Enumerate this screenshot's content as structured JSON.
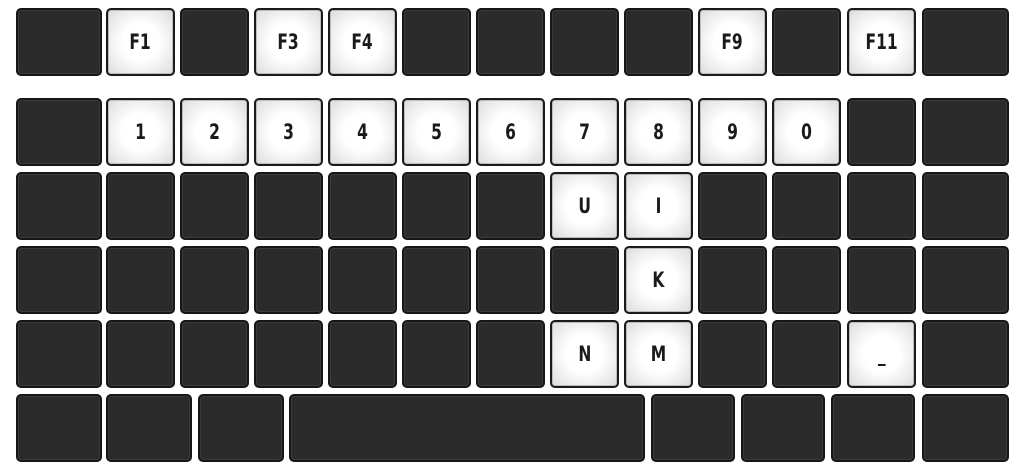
{
  "keyboard": {
    "rows": [
      {
        "name": "function-row",
        "keys": [
          {
            "id": "esc",
            "label": "",
            "lit": false
          },
          {
            "id": "f1",
            "label": "F1",
            "lit": true
          },
          {
            "id": "f2",
            "label": "",
            "lit": false
          },
          {
            "id": "f3",
            "label": "F3",
            "lit": true
          },
          {
            "id": "f4",
            "label": "F4",
            "lit": true
          },
          {
            "id": "f5",
            "label": "",
            "lit": false
          },
          {
            "id": "f6",
            "label": "",
            "lit": false
          },
          {
            "id": "f7",
            "label": "",
            "lit": false
          },
          {
            "id": "f8",
            "label": "",
            "lit": false
          },
          {
            "id": "f9",
            "label": "F9",
            "lit": true
          },
          {
            "id": "f10",
            "label": "",
            "lit": false
          },
          {
            "id": "f11",
            "label": "F11",
            "lit": true
          },
          {
            "id": "f12",
            "label": "",
            "lit": false
          }
        ]
      },
      {
        "name": "number-row",
        "keys": [
          {
            "id": "backtick",
            "label": "",
            "lit": false
          },
          {
            "id": "digit-1",
            "label": "1",
            "lit": true
          },
          {
            "id": "digit-2",
            "label": "2",
            "lit": true
          },
          {
            "id": "digit-3",
            "label": "3",
            "lit": true
          },
          {
            "id": "digit-4",
            "label": "4",
            "lit": true
          },
          {
            "id": "digit-5",
            "label": "5",
            "lit": true
          },
          {
            "id": "digit-6",
            "label": "6",
            "lit": true
          },
          {
            "id": "digit-7",
            "label": "7",
            "lit": true
          },
          {
            "id": "digit-8",
            "label": "8",
            "lit": true
          },
          {
            "id": "digit-9",
            "label": "9",
            "lit": true
          },
          {
            "id": "digit-0",
            "label": "0",
            "lit": true
          },
          {
            "id": "minus",
            "label": "",
            "lit": false
          },
          {
            "id": "backspace",
            "label": "",
            "lit": false
          }
        ]
      },
      {
        "name": "top-letter-row",
        "keys": [
          {
            "id": "tab",
            "label": "",
            "lit": false
          },
          {
            "id": "q",
            "label": "",
            "lit": false
          },
          {
            "id": "w",
            "label": "",
            "lit": false
          },
          {
            "id": "e",
            "label": "",
            "lit": false
          },
          {
            "id": "r",
            "label": "",
            "lit": false
          },
          {
            "id": "t",
            "label": "",
            "lit": false
          },
          {
            "id": "y",
            "label": "",
            "lit": false
          },
          {
            "id": "u",
            "label": "U",
            "lit": true
          },
          {
            "id": "i",
            "label": "I",
            "lit": true
          },
          {
            "id": "o",
            "label": "",
            "lit": false
          },
          {
            "id": "p",
            "label": "",
            "lit": false
          },
          {
            "id": "bracket-left",
            "label": "",
            "lit": false
          },
          {
            "id": "bracket-right",
            "label": "",
            "lit": false
          }
        ]
      },
      {
        "name": "home-row",
        "keys": [
          {
            "id": "caps-lock",
            "label": "",
            "lit": false
          },
          {
            "id": "a",
            "label": "",
            "lit": false
          },
          {
            "id": "s",
            "label": "",
            "lit": false
          },
          {
            "id": "d",
            "label": "",
            "lit": false
          },
          {
            "id": "f",
            "label": "",
            "lit": false
          },
          {
            "id": "g",
            "label": "",
            "lit": false
          },
          {
            "id": "h",
            "label": "",
            "lit": false
          },
          {
            "id": "j",
            "label": "",
            "lit": false
          },
          {
            "id": "k",
            "label": "K",
            "lit": true
          },
          {
            "id": "l",
            "label": "",
            "lit": false
          },
          {
            "id": "semicolon",
            "label": "",
            "lit": false
          },
          {
            "id": "quote",
            "label": "",
            "lit": false
          },
          {
            "id": "enter",
            "label": "",
            "lit": false
          }
        ]
      },
      {
        "name": "bottom-letter-row",
        "keys": [
          {
            "id": "shift-left",
            "label": "",
            "lit": false
          },
          {
            "id": "z",
            "label": "",
            "lit": false
          },
          {
            "id": "x",
            "label": "",
            "lit": false
          },
          {
            "id": "c",
            "label": "",
            "lit": false
          },
          {
            "id": "v",
            "label": "",
            "lit": false
          },
          {
            "id": "b",
            "label": "",
            "lit": false
          },
          {
            "id": "b2",
            "label": "",
            "lit": false
          },
          {
            "id": "n",
            "label": "N",
            "lit": true
          },
          {
            "id": "m",
            "label": "M",
            "lit": true
          },
          {
            "id": "comma",
            "label": "",
            "lit": false
          },
          {
            "id": "period",
            "label": "",
            "lit": false
          },
          {
            "id": "underscore",
            "label": "_",
            "lit": true
          },
          {
            "id": "shift-right",
            "label": "",
            "lit": false
          }
        ]
      },
      {
        "name": "modifier-row",
        "keys": [
          {
            "id": "ctrl-left",
            "label": "",
            "lit": false
          },
          {
            "id": "win-left",
            "label": "",
            "lit": false
          },
          {
            "id": "alt-left",
            "label": "",
            "lit": false
          },
          {
            "id": "space",
            "label": "",
            "lit": false
          },
          {
            "id": "alt-right",
            "label": "",
            "lit": false
          },
          {
            "id": "fn",
            "label": "",
            "lit": false
          },
          {
            "id": "menu",
            "label": "",
            "lit": false
          },
          {
            "id": "ctrl-right",
            "label": "",
            "lit": false
          }
        ]
      }
    ]
  }
}
